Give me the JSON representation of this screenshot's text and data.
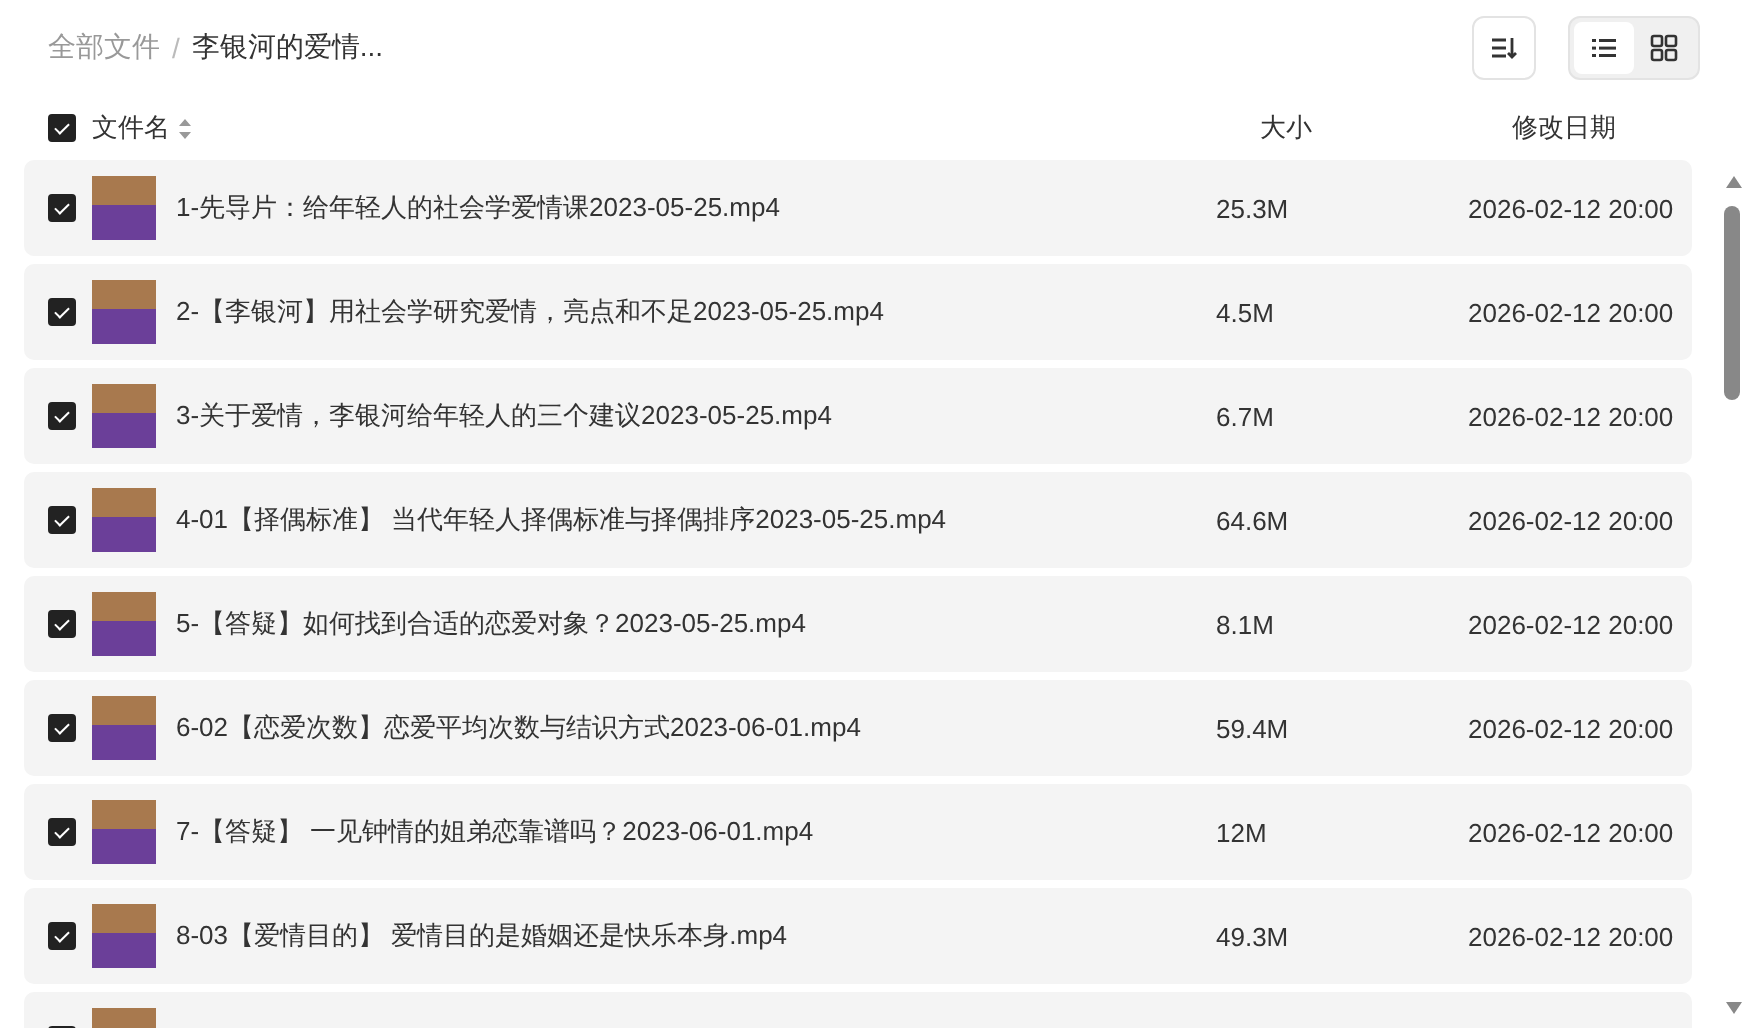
{
  "breadcrumb_separator": "/",
  "breadcrumb": [
    {
      "label": "全部文件"
    },
    {
      "label": "李银河的爱情..."
    }
  ],
  "view_toggle": [
    {
      "kind": "list",
      "selected": true
    },
    {
      "kind": "grid",
      "selected": false
    }
  ],
  "table": {
    "all_checked": true,
    "columns": [
      {
        "label": "文件名",
        "sortable": true
      },
      {
        "label": "大小"
      },
      {
        "label": "修改日期"
      }
    ],
    "rows": [
      {
        "checked": true,
        "name": "1-先导片：给年轻人的社会学爱情课2023-05-25.mp4",
        "size": "25.3M",
        "date": "2026-02-12 20:00"
      },
      {
        "checked": true,
        "name": "2-【李银河】用社会学研究爱情，亮点和不足2023-05-25.mp4",
        "size": "4.5M",
        "date": "2026-02-12 20:00"
      },
      {
        "checked": true,
        "name": "3-关于爱情，李银河给年轻人的三个建议2023-05-25.mp4",
        "size": "6.7M",
        "date": "2026-02-12 20:00"
      },
      {
        "checked": true,
        "name": "4-01【择偶标准】 当代年轻人择偶标准与择偶排序2023-05-25.mp4",
        "size": "64.6M",
        "date": "2026-02-12 20:00"
      },
      {
        "checked": true,
        "name": "5-【答疑】如何找到合适的恋爱对象？2023-05-25.mp4",
        "size": "8.1M",
        "date": "2026-02-12 20:00"
      },
      {
        "checked": true,
        "name": "6-02【恋爱次数】恋爱平均次数与结识方式2023-06-01.mp4",
        "size": "59.4M",
        "date": "2026-02-12 20:00"
      },
      {
        "checked": true,
        "name": "7-【答疑】 一见钟情的姐弟恋靠谱吗？2023-06-01.mp4",
        "size": "12M",
        "date": "2026-02-12 20:00"
      },
      {
        "checked": true,
        "name": "8-03【爱情目的】 爱情目的是婚姻还是快乐本身.mp4",
        "size": "49.3M",
        "date": "2026-02-12 20:00"
      },
      {
        "checked": true
      }
    ]
  }
}
